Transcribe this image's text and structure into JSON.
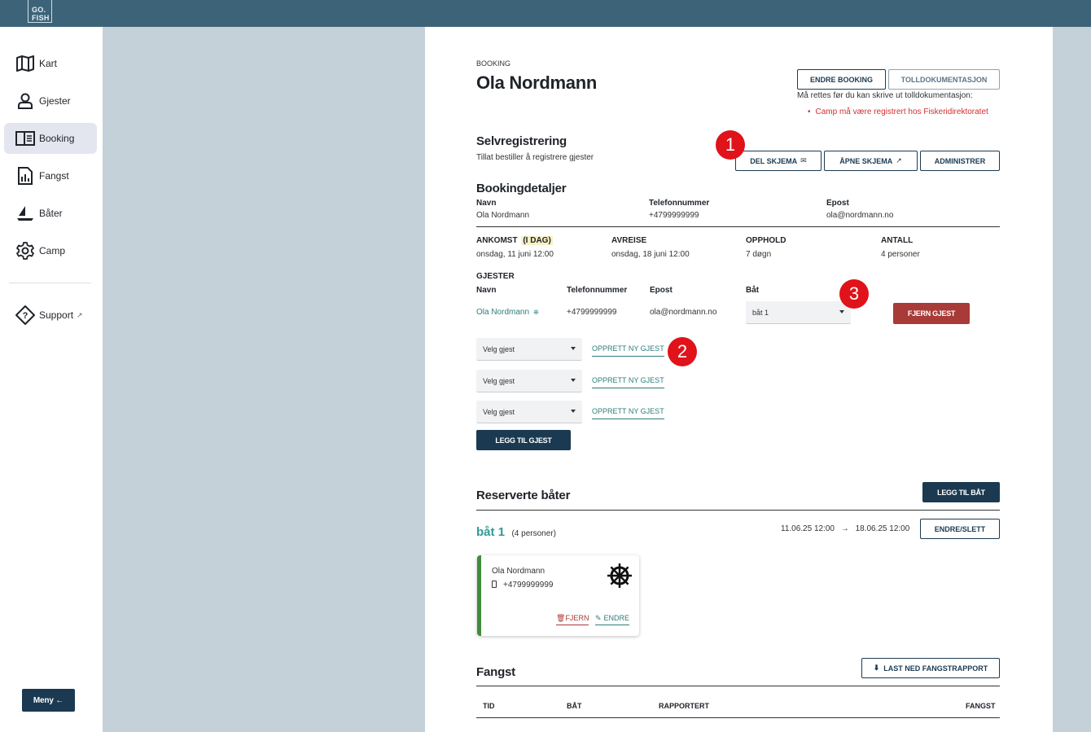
{
  "app": {
    "logo_line1": "GO.",
    "logo_line2": "FISH"
  },
  "sidebar": {
    "items": [
      {
        "label": "Kart",
        "icon": "map-icon"
      },
      {
        "label": "Gjester",
        "icon": "person-icon"
      },
      {
        "label": "Booking",
        "icon": "book-icon",
        "active": true
      },
      {
        "label": "Fangst",
        "icon": "report-icon"
      },
      {
        "label": "Båter",
        "icon": "boat-icon"
      },
      {
        "label": "Camp",
        "icon": "gear-icon"
      }
    ],
    "support": {
      "label": "Support",
      "icon": "help-icon"
    },
    "menu_button": "Meny ←"
  },
  "header": {
    "breadcrumb": "BOOKING",
    "title": "Ola Nordmann",
    "edit_button": "ENDRE BOOKING",
    "customs_button": "TOLLDOKUMENTASJON",
    "warning_intro": "Må rettes før du kan skrive ut tolldokumentasjon:",
    "warning_item": "Camp må være registrert hos Fiskeridirektoratet"
  },
  "self_registration": {
    "title": "Selvregistrering",
    "subtitle": "Tillat bestiller å registrere gjester",
    "share_button": "DEL SKJEMA",
    "open_button": "ÅPNE SKJEMA",
    "admin_button": "ADMINISTRER"
  },
  "booking_details": {
    "title": "Bookingdetaljer",
    "name_label": "Navn",
    "name_value": "Ola Nordmann",
    "phone_label": "Telefonnummer",
    "phone_value": "+4799999999",
    "email_label": "Epost",
    "email_value": "ola@nordmann.no",
    "arrival_label": "ANKOMST",
    "arrival_tag": "(I DAG)",
    "arrival_value": "onsdag, 11 juni 12:00",
    "departure_label": "AVREISE",
    "departure_value": "onsdag, 18 juni 12:00",
    "stay_label": "OPPHOLD",
    "stay_value": "7 døgn",
    "count_label": "ANTALL",
    "count_value": "4 personer"
  },
  "guests": {
    "title": "GJESTER",
    "col_name": "Navn",
    "col_phone": "Telefonnummer",
    "col_email": "Epost",
    "col_boat": "Båt",
    "row": {
      "name": "Ola Nordmann",
      "phone": "+4799999999",
      "email": "ola@nordmann.no",
      "boat": "båt 1"
    },
    "remove_button": "FJERN GJEST",
    "select_placeholder": "Velg gjest",
    "create_link": "OPPRETT NY GJEST",
    "add_button": "LEGG TIL GJEST"
  },
  "annotations": {
    "one": "1",
    "two": "2",
    "three": "3"
  },
  "boats": {
    "title": "Reserverte båter",
    "add_button": "LEGG TIL BÅT",
    "boat_name": "båt 1",
    "boat_capacity": "(4 personer)",
    "date_from": "11.06.25 12:00",
    "arrow": "→",
    "date_to": "18.06.25 12:00",
    "edit_button": "ENDRE/SLETT",
    "card": {
      "name": "Ola Nordmann",
      "phone": "+4799999999",
      "remove_link": "FJERN",
      "edit_link": "ENDRE"
    }
  },
  "catch": {
    "title": "Fangst",
    "download_button": "LAST NED FANGSTRAPPORT",
    "col_time": "TID",
    "col_boat": "BÅT",
    "col_reported": "RAPPORTERT",
    "col_catch": "FANGST"
  },
  "colors": {
    "topbar": "#3d6378",
    "primary": "#1b3a52",
    "danger": "#a83a38",
    "teal": "#2e7d7a",
    "badge": "#e0121a",
    "card_accent": "#3e8c3e"
  }
}
